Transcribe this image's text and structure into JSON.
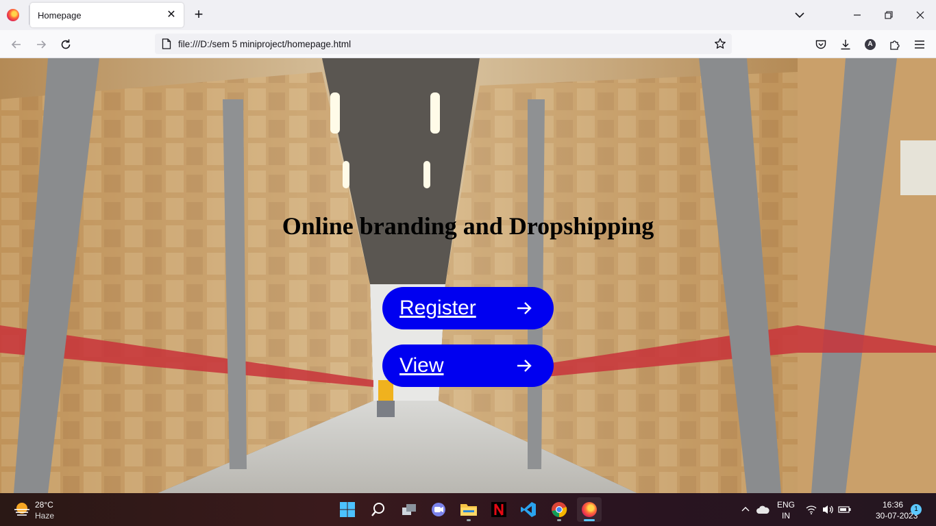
{
  "browser": {
    "tab_title": "Homepage",
    "url": "file:///D:/sem 5 miniproject/homepage.html",
    "account_initial": "A"
  },
  "page": {
    "headline": "Online branding and Dropshipping",
    "buttons": [
      {
        "label": "Register"
      },
      {
        "label": "View"
      }
    ],
    "button_color": "#0000f0"
  },
  "taskbar": {
    "weather_temp": "28°C",
    "weather_condition": "Haze",
    "language_line1": "ENG",
    "language_line2": "IN",
    "time": "16:36",
    "date": "30-07-2023",
    "notification_count": "1"
  }
}
